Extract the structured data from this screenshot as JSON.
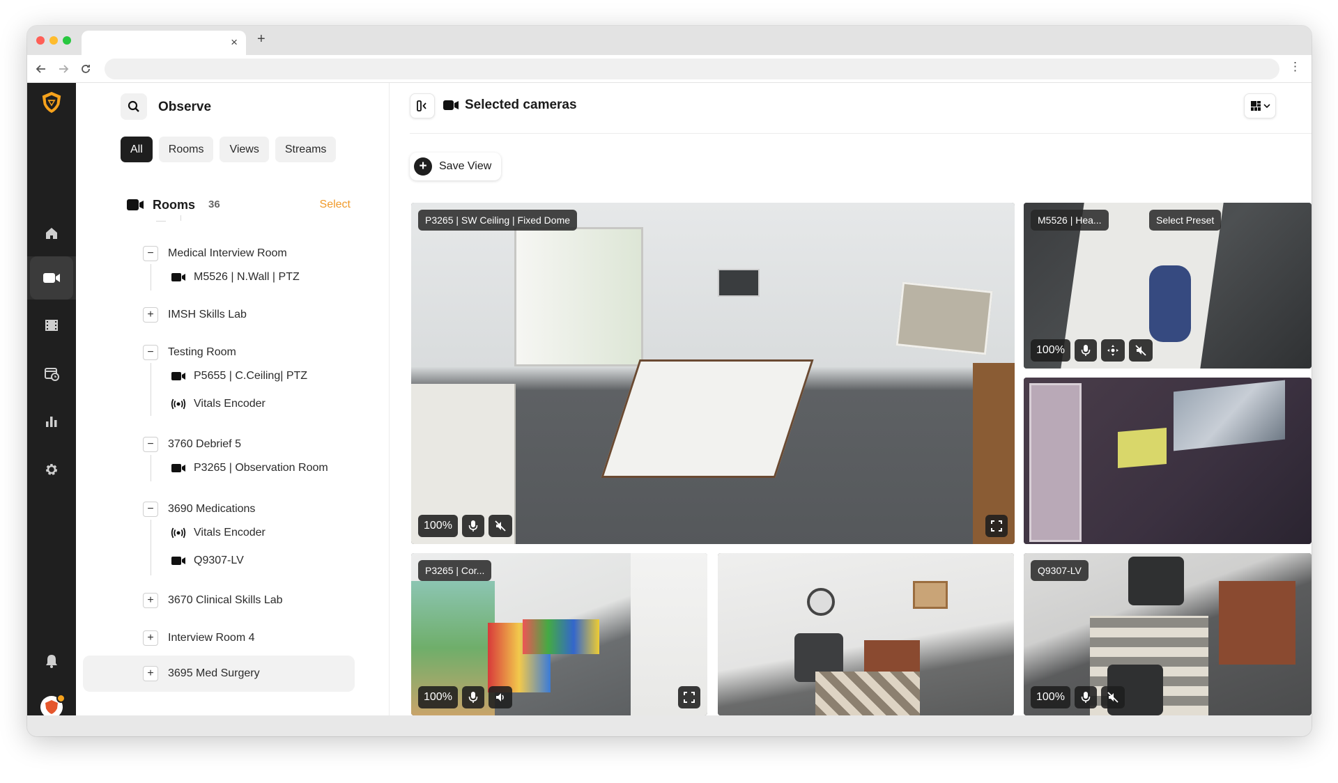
{
  "browser": {
    "tab_title": "",
    "tab_close": "×",
    "new_tab": "+",
    "url": ""
  },
  "rail": {
    "items": [
      "logo-icon",
      "home-icon",
      "camera-icon",
      "film-icon",
      "calendar-icon",
      "chart-icon",
      "gear-icon",
      "bell-icon",
      "avatar"
    ]
  },
  "sidebar": {
    "title": "Observe",
    "filters": [
      "All",
      "Rooms",
      "Views",
      "Streams"
    ],
    "active_filter": "All",
    "rooms_header": {
      "label": "Rooms",
      "count": "36",
      "select": "Select"
    },
    "tree": [
      {
        "type": "room",
        "label": "Medical Interview Room",
        "toggle": "−"
      },
      {
        "type": "camera",
        "label": "M5526 | N.Wall | PTZ"
      },
      {
        "type": "room",
        "label": "IMSH Skills Lab",
        "toggle": "+"
      },
      {
        "type": "room",
        "label": "Testing Room",
        "toggle": "−"
      },
      {
        "type": "camera",
        "label": "P5655 | C.Ceiling| PTZ"
      },
      {
        "type": "encoder",
        "label": "Vitals Encoder"
      },
      {
        "type": "room",
        "label": "3760 Debrief 5",
        "toggle": "−"
      },
      {
        "type": "camera",
        "label": "P3265 | Observation Room"
      },
      {
        "type": "room",
        "label": "3690 Medications",
        "toggle": "−"
      },
      {
        "type": "encoder",
        "label": "Vitals Encoder"
      },
      {
        "type": "camera",
        "label": "Q9307-LV"
      },
      {
        "type": "room",
        "label": "3670 Clinical Skills Lab",
        "toggle": "+"
      },
      {
        "type": "room",
        "label": "Interview Room 4",
        "toggle": "+"
      },
      {
        "type": "room",
        "label": "3695 Med Surgery",
        "toggle": "+"
      }
    ]
  },
  "main": {
    "title": "Selected cameras",
    "save_view": "Save View",
    "tiles": [
      {
        "label": "P3265 | SW Ceiling | Fixed Dome",
        "zoom": "100%"
      },
      {
        "label": "M5526 | Hea...",
        "preset": "Select Preset",
        "zoom": "100%"
      },
      {
        "label": "",
        "zoom": ""
      },
      {
        "label": "P3265 | Cor...",
        "zoom": "100%"
      },
      {
        "label": "",
        "zoom": ""
      },
      {
        "label": "Q9307-LV",
        "zoom": "100%"
      }
    ]
  },
  "colors": {
    "accent": "#f09a2a",
    "rail": "#1f1f1f",
    "chip_active": "#1e1e1e"
  }
}
